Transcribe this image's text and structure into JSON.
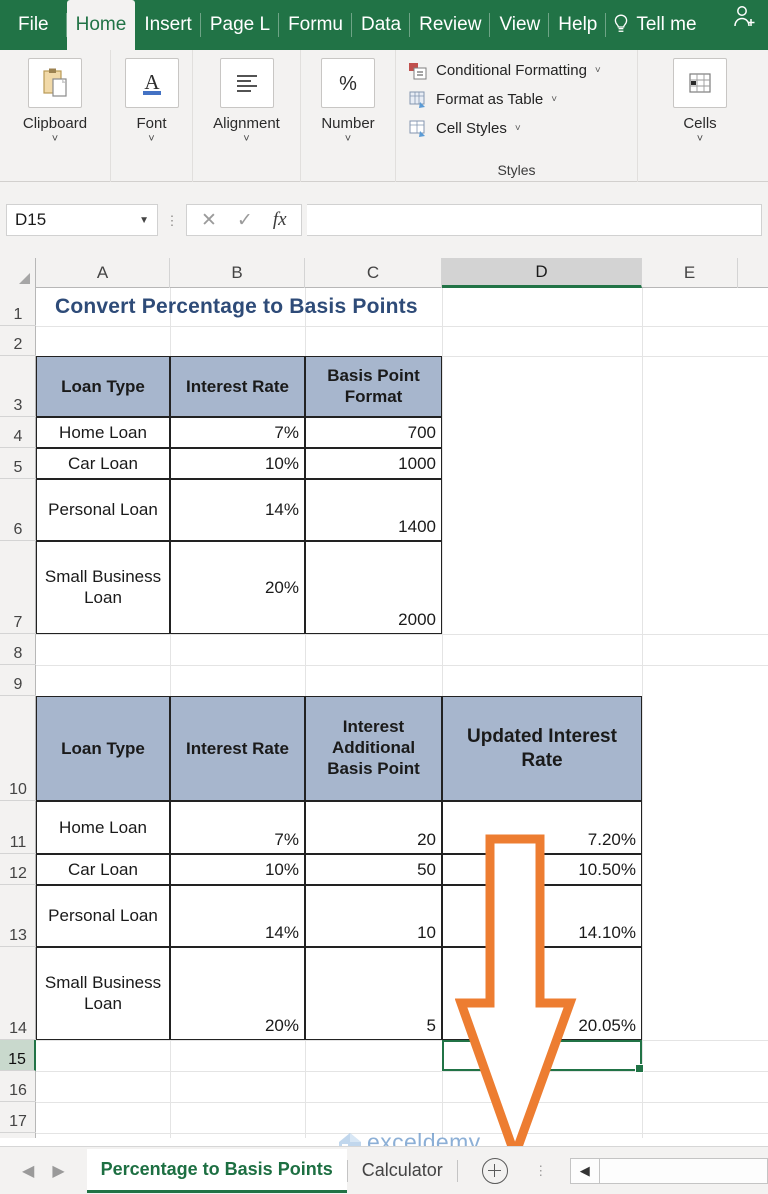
{
  "ribbon": {
    "tabs": [
      {
        "label": "File",
        "active": false
      },
      {
        "label": "Home",
        "active": true
      },
      {
        "label": "Insert",
        "active": false
      },
      {
        "label": "Page L",
        "active": false
      },
      {
        "label": "Formu",
        "active": false
      },
      {
        "label": "Data",
        "active": false
      },
      {
        "label": "Review",
        "active": false
      },
      {
        "label": "View",
        "active": false
      },
      {
        "label": "Help",
        "active": false
      }
    ],
    "tell_me": "Tell me",
    "share_icon": "person-add-icon",
    "groups": [
      {
        "label": "Clipboard",
        "icon": "clipboard-icon"
      },
      {
        "label": "Font",
        "icon": "font-a-icon"
      },
      {
        "label": "Alignment",
        "icon": "alignment-icon"
      },
      {
        "label": "Number",
        "icon": "percent-icon"
      }
    ],
    "styles": {
      "title": "Styles",
      "items": [
        {
          "label": "Conditional Formatting",
          "icon": "conditional-formatting-icon"
        },
        {
          "label": "Format as Table",
          "icon": "format-as-table-icon"
        },
        {
          "label": "Cell Styles",
          "icon": "cell-styles-icon"
        }
      ]
    },
    "cells_group": {
      "label": "Cells",
      "icon": "cells-icon"
    }
  },
  "formula_bar": {
    "name_box": "D15",
    "formula": "",
    "cancel_icon": "close-icon",
    "confirm_icon": "check-icon",
    "fx_label": "fx"
  },
  "grid": {
    "columns": [
      "A",
      "B",
      "C",
      "D",
      "E"
    ],
    "selected_column": "D",
    "rows": [
      "1",
      "2",
      "3",
      "4",
      "5",
      "6",
      "7",
      "8",
      "9",
      "10",
      "11",
      "12",
      "13",
      "14",
      "15",
      "16",
      "17"
    ],
    "selected_row": "15",
    "selected_cell": "D15",
    "title": "Convert Percentage to Basis Points",
    "table1": {
      "headers": [
        "Loan Type",
        "Interest Rate",
        "Basis Point Format"
      ],
      "rows": [
        {
          "row": "4",
          "loan_type": "Home Loan",
          "interest_rate": "7%",
          "basis_points": "700"
        },
        {
          "row": "5",
          "loan_type": "Car Loan",
          "interest_rate": "10%",
          "basis_points": "1000"
        },
        {
          "row": "6",
          "loan_type": "Personal Loan",
          "interest_rate": "14%",
          "basis_points": "1400"
        },
        {
          "row": "7",
          "loan_type": "Small Business Loan",
          "interest_rate": "20%",
          "basis_points": "2000"
        }
      ]
    },
    "table2": {
      "headers": [
        "Loan Type",
        "Interest Rate",
        "Interest Additional Basis Point",
        "Updated Interest Rate"
      ],
      "rows": [
        {
          "row": "11",
          "loan_type": "Home Loan",
          "interest_rate": "7%",
          "additional_bp": "20",
          "updated_rate": "7.20%"
        },
        {
          "row": "12",
          "loan_type": "Car Loan",
          "interest_rate": "10%",
          "additional_bp": "50",
          "updated_rate": "10.50%"
        },
        {
          "row": "13",
          "loan_type": "Personal Loan",
          "interest_rate": "14%",
          "additional_bp": "10",
          "updated_rate": "14.10%"
        },
        {
          "row": "14",
          "loan_type": "Small Business Loan",
          "interest_rate": "20%",
          "additional_bp": "5",
          "updated_rate": "20.05%"
        }
      ]
    }
  },
  "annotation": {
    "shape": "down-arrow",
    "color": "#ED7D31"
  },
  "watermark": {
    "text": "exceldemy",
    "color": "#2f6fb5"
  },
  "sheet_tabs": {
    "tabs": [
      {
        "label": "Percentage to Basis Points",
        "active": true
      },
      {
        "label": "Calculator",
        "active": false
      }
    ],
    "add_label": "+",
    "prev_icon": "chevron-left-icon",
    "next_icon": "chevron-right-icon"
  },
  "colors": {
    "excel_green": "#217346",
    "header_fill": "#a7b6cd",
    "title_text": "#2e4b78",
    "arrow": "#ED7D31"
  }
}
